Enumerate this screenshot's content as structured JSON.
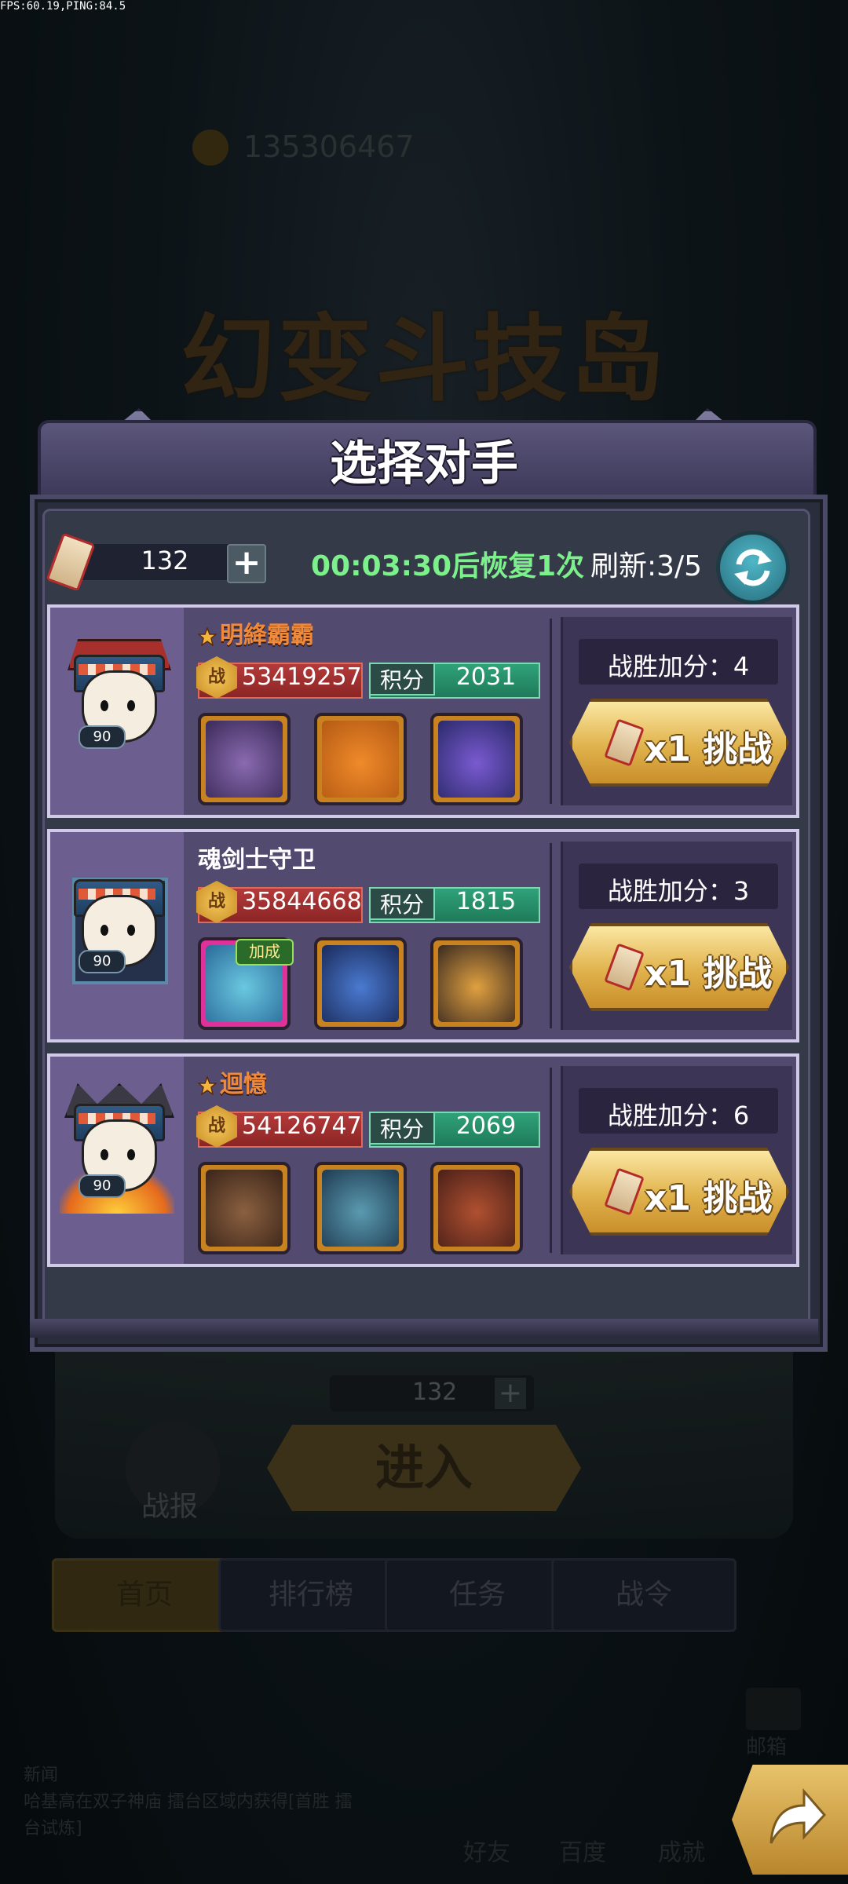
{
  "debug": {
    "fps_ping": "FPS:60.19,PING:84.5"
  },
  "background": {
    "game_title": "幻变斗技岛",
    "player_id": "135306467",
    "ticket_count": "132",
    "enter_button": "进入",
    "report_label": "战报",
    "tabs": [
      {
        "label": "首页",
        "selected": true
      },
      {
        "label": "排行榜",
        "selected": false
      },
      {
        "label": "任务",
        "selected": false
      },
      {
        "label": "战令",
        "selected": false
      }
    ],
    "mail_label": "邮箱",
    "notice_title": "新闻",
    "notice_text": "哈基高在双子神庙 擂台区域内获得[首胜 擂台试炼]",
    "bottom_labels": [
      "好友",
      "百度",
      "成就"
    ]
  },
  "dialog": {
    "title": "选择对手",
    "ticket_count": "132",
    "recover_text": "00:03:30后恢复1次",
    "refresh_text": "刷新:3/5",
    "score_label": "积分",
    "power_icon_text": "战",
    "challenge_label": "x1 挑战",
    "boost_tag": "加成",
    "opponents": [
      {
        "name": "明絳霸霸",
        "name_style": "gold",
        "level": "90",
        "power": "53419257",
        "score": "2031",
        "win_bonus": "战胜加分：4"
      },
      {
        "name": "魂剑士守卫",
        "name_style": "white",
        "level": "90",
        "power": "35844668",
        "score": "1815",
        "win_bonus": "战胜加分：3"
      },
      {
        "name": "迴憶",
        "name_style": "gold",
        "level": "90",
        "power": "54126747",
        "score": "2069",
        "win_bonus": "战胜加分：6"
      }
    ]
  },
  "colors": {
    "recover_green": "#7cf08a",
    "gold_name": "#f08a3a",
    "card_bg": "#534a70",
    "button_gold": "#e0b24c"
  },
  "icons": [
    "ticket-icon",
    "plus-icon",
    "refresh-icon",
    "star-icon",
    "power-icon",
    "share-icon"
  ]
}
